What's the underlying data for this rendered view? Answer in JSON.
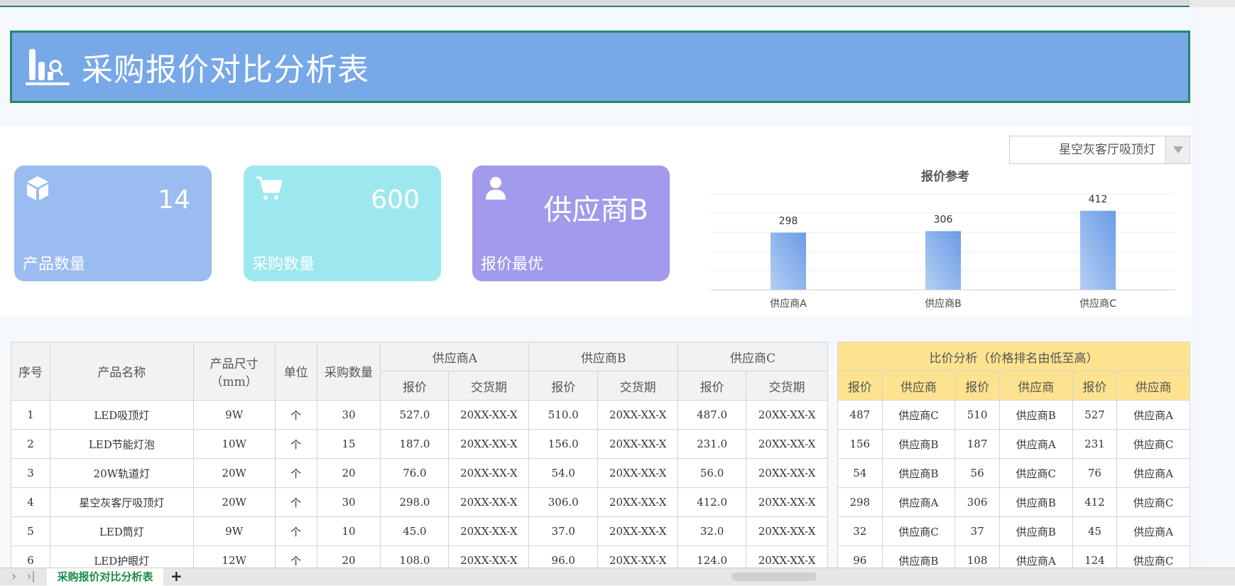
{
  "title": "采购报价对比分析表",
  "cards": [
    {
      "label": "产品数量",
      "value": "14",
      "icon": "cube-icon",
      "color": "#9abcf0"
    },
    {
      "label": "采购数量",
      "value": "600",
      "icon": "cart-icon",
      "color": "#9ce8ee"
    },
    {
      "label": "报价最优",
      "value": "供应商B",
      "icon": "user-icon",
      "color": "#a29aec"
    }
  ],
  "dropdown": {
    "value": "星空灰客厅吸顶灯"
  },
  "chart_data": {
    "type": "bar",
    "title": "报价参考",
    "categories": [
      "供应商A",
      "供应商B",
      "供应商C"
    ],
    "values": [
      298,
      306,
      412
    ],
    "ylim": [
      0,
      500
    ],
    "grid_step": 100,
    "grid": true
  },
  "table": {
    "headers": {
      "index": "序号",
      "name": "产品名称",
      "size": "产品尺寸",
      "size_unit": "（mm）",
      "unit": "单位",
      "qty": "采购数量",
      "suppliers": [
        "供应商A",
        "供应商B",
        "供应商C"
      ],
      "price": "报价",
      "delivery": "交货期"
    },
    "rows": [
      [
        "1",
        "LED吸顶灯",
        "9W",
        "个",
        "30",
        "527.0",
        "20XX-XX-X",
        "510.0",
        "20XX-XX-X",
        "487.0",
        "20XX-XX-X"
      ],
      [
        "2",
        "LED节能灯泡",
        "10W",
        "个",
        "15",
        "187.0",
        "20XX-XX-X",
        "156.0",
        "20XX-XX-X",
        "231.0",
        "20XX-XX-X"
      ],
      [
        "3",
        "20W轨道灯",
        "20W",
        "个",
        "20",
        "76.0",
        "20XX-XX-X",
        "54.0",
        "20XX-XX-X",
        "56.0",
        "20XX-XX-X"
      ],
      [
        "4",
        "星空灰客厅吸顶灯",
        "20W",
        "个",
        "30",
        "298.0",
        "20XX-XX-X",
        "306.0",
        "20XX-XX-X",
        "412.0",
        "20XX-XX-X"
      ],
      [
        "5",
        "LED筒灯",
        "9W",
        "个",
        "10",
        "45.0",
        "20XX-XX-X",
        "37.0",
        "20XX-XX-X",
        "32.0",
        "20XX-XX-X"
      ],
      [
        "6",
        "LED护眼灯",
        "12W",
        "个",
        "20",
        "108.0",
        "20XX-XX-X",
        "96.0",
        "20XX-XX-X",
        "124.0",
        "20XX-XX-X"
      ]
    ]
  },
  "compare": {
    "title": "比价分析（价格排名由低至高）",
    "cols": [
      "报价",
      "供应商",
      "报价",
      "供应商",
      "报价",
      "供应商"
    ],
    "rows": [
      [
        "487",
        "供应商C",
        "510",
        "供应商B",
        "527",
        "供应商A"
      ],
      [
        "156",
        "供应商B",
        "187",
        "供应商A",
        "231",
        "供应商C"
      ],
      [
        "54",
        "供应商B",
        "56",
        "供应商C",
        "76",
        "供应商A"
      ],
      [
        "298",
        "供应商A",
        "306",
        "供应商B",
        "412",
        "供应商C"
      ],
      [
        "32",
        "供应商C",
        "37",
        "供应商B",
        "45",
        "供应商A"
      ],
      [
        "96",
        "供应商B",
        "108",
        "供应商A",
        "124",
        "供应商C"
      ]
    ]
  },
  "sheet_tab": "采购报价对比分析表",
  "add_sheet": "+",
  "nav": {
    "next": "›",
    "last": "›|"
  }
}
